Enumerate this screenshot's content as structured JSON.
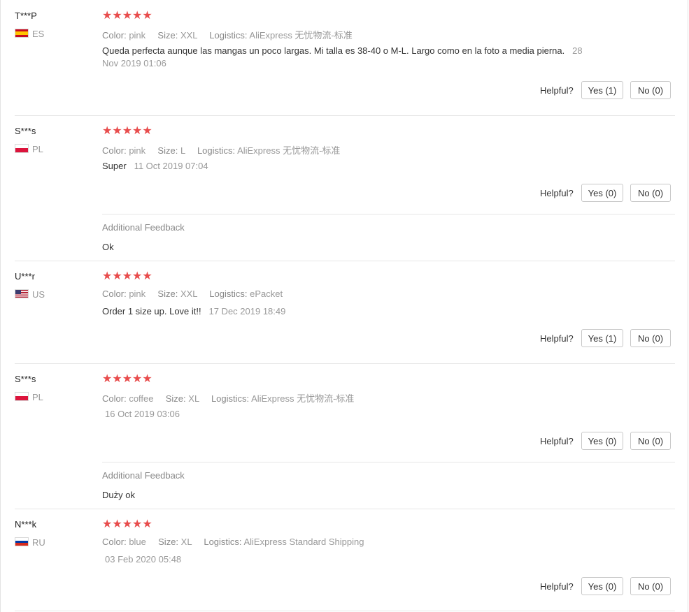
{
  "colors": {
    "star": "#e84c4c",
    "muted": "#999999",
    "text": "#333333",
    "divider": "#e6e6e6"
  },
  "labels": {
    "color": "Color:",
    "size": "Size:",
    "logistics": "Logistics:",
    "helpful": "Helpful?",
    "additional_feedback": "Additional Feedback",
    "stars": "★★★★★"
  },
  "reviews": [
    {
      "user": "T***P",
      "country": "ES",
      "flag_icon": "spain-flag-icon",
      "rating": 5,
      "color": "pink",
      "size": "XXL",
      "logistics": "AliExpress 无忧物流-标准",
      "text": "Queda perfecta aunque las mangas un poco largas. Mi talla es 38-40 o M-L. Largo como en la foto a media pierna.",
      "date_part1": "28",
      "date_part2": "Nov 2019 01:06",
      "yes": "Yes (1)",
      "no": "No (0)"
    },
    {
      "user": "S***s",
      "country": "PL",
      "flag_icon": "poland-flag-icon",
      "rating": 5,
      "color": "pink",
      "size": "L",
      "logistics": "AliExpress 无忧物流-标准",
      "text": "Super",
      "date": "11 Oct 2019 07:04",
      "yes": "Yes (0)",
      "no": "No (0)",
      "additional": "Ok"
    },
    {
      "user": "U***r",
      "country": "US",
      "flag_icon": "usa-flag-icon",
      "rating": 5,
      "color": "pink",
      "size": "XXL",
      "logistics": "ePacket",
      "text": "Order 1 size up. Love it!!",
      "date": "17 Dec 2019 18:49",
      "yes": "Yes (1)",
      "no": "No (0)"
    },
    {
      "user": "S***s",
      "country": "PL",
      "flag_icon": "poland-flag-icon",
      "rating": 5,
      "color": "coffee",
      "size": "XL",
      "logistics": "AliExpress 无忧物流-标准",
      "date": "16 Oct 2019 03:06",
      "yes": "Yes (0)",
      "no": "No (0)",
      "additional": "Duży ok"
    },
    {
      "user": "N***k",
      "country": "RU",
      "flag_icon": "russia-flag-icon",
      "rating": 5,
      "color": "blue",
      "size": "XL",
      "logistics": "AliExpress Standard Shipping",
      "date": "03 Feb 2020 05:48",
      "yes": "Yes (0)",
      "no": "No (0)"
    }
  ]
}
